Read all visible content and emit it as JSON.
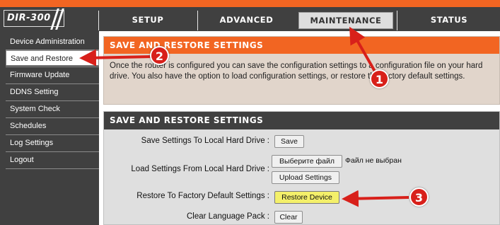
{
  "brand": {
    "logo": "DIR-300"
  },
  "tabs": [
    {
      "label": "SETUP",
      "active": false
    },
    {
      "label": "ADVANCED",
      "active": false
    },
    {
      "label": "MAINTENANCE",
      "active": true
    },
    {
      "label": "STATUS",
      "active": false
    }
  ],
  "sidebar": {
    "items": [
      {
        "label": "Device Administration"
      },
      {
        "label": "Save and Restore",
        "active": true
      },
      {
        "label": "Firmware Update"
      },
      {
        "label": "DDNS Setting"
      },
      {
        "label": "System Check"
      },
      {
        "label": "Schedules"
      },
      {
        "label": "Log Settings"
      },
      {
        "label": "Logout"
      }
    ]
  },
  "intro": {
    "title": "SAVE AND RESTORE SETTINGS",
    "text": "Once the router is configured you can save the configuration settings to a configuration file on your hard drive. You also have the option to load configuration settings, or restore the factory default settings."
  },
  "settings": {
    "title": "SAVE AND RESTORE SETTINGS",
    "save_label": "Save Settings To Local Hard Drive :",
    "save_button": "Save",
    "load_label": "Load Settings From Local Hard Drive :",
    "choose_file_button": "Выберите файл",
    "file_status": "Файл не выбран",
    "upload_button": "Upload Settings",
    "restore_label": "Restore To Factory Default Settings :",
    "restore_button": "Restore Device",
    "clear_lang_label": "Clear Language Pack :",
    "clear_button": "Clear"
  },
  "annotations": {
    "c1": "1",
    "c2": "2",
    "c3": "3"
  },
  "colors": {
    "brand_orange": "#f26522",
    "dark_gray": "#404040",
    "callout_red": "#d8201a",
    "highlight_yellow": "#f4f06a"
  }
}
